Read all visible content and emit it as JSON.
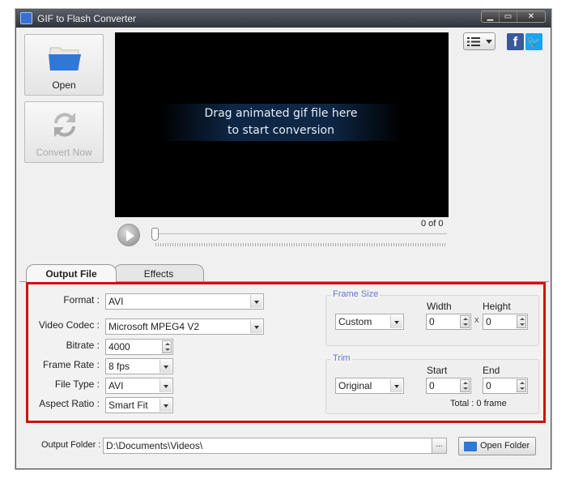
{
  "window": {
    "title": "GIF to Flash Converter",
    "controls": [
      "minimize",
      "maximize",
      "close"
    ]
  },
  "sidebar": {
    "open_label": "Open",
    "convert_label": "Convert Now"
  },
  "preview": {
    "drop_line1": "Drag animated gif file here",
    "drop_line2": "to start conversion",
    "frame_counter": "0 of 0"
  },
  "social": {
    "facebook": "f",
    "twitter": "t"
  },
  "tabs": [
    {
      "label": "Output File",
      "active": true
    },
    {
      "label": "Effects",
      "active": false
    }
  ],
  "output": {
    "format": {
      "label": "Format :",
      "value": "AVI"
    },
    "video_codec": {
      "label": "Video Codec :",
      "value": "Microsoft MPEG4 V2"
    },
    "bitrate": {
      "label": "Bitrate :",
      "value": "4000"
    },
    "frame_rate": {
      "label": "Frame Rate :",
      "value": "8 fps"
    },
    "file_type": {
      "label": "File Type :",
      "value": "AVI"
    },
    "aspect_ratio": {
      "label": "Aspect Ratio :",
      "value": "Smart Fit"
    }
  },
  "frame_size": {
    "title": "Frame Size",
    "preset": "Custom",
    "width_label": "Width",
    "height_label": "Height",
    "width": "0",
    "height": "0",
    "separator": "x"
  },
  "trim": {
    "title": "Trim",
    "preset": "Original",
    "start_label": "Start",
    "end_label": "End",
    "start": "0",
    "end": "0",
    "total": "Total : 0 frame"
  },
  "output_folder": {
    "label": "Output Folder :",
    "path": "D:\\Documents\\Videos\\",
    "browse": "...",
    "open_label": "Open Folder"
  },
  "colors": {
    "highlight_border": "#d01010",
    "group_title": "#6677cc"
  }
}
